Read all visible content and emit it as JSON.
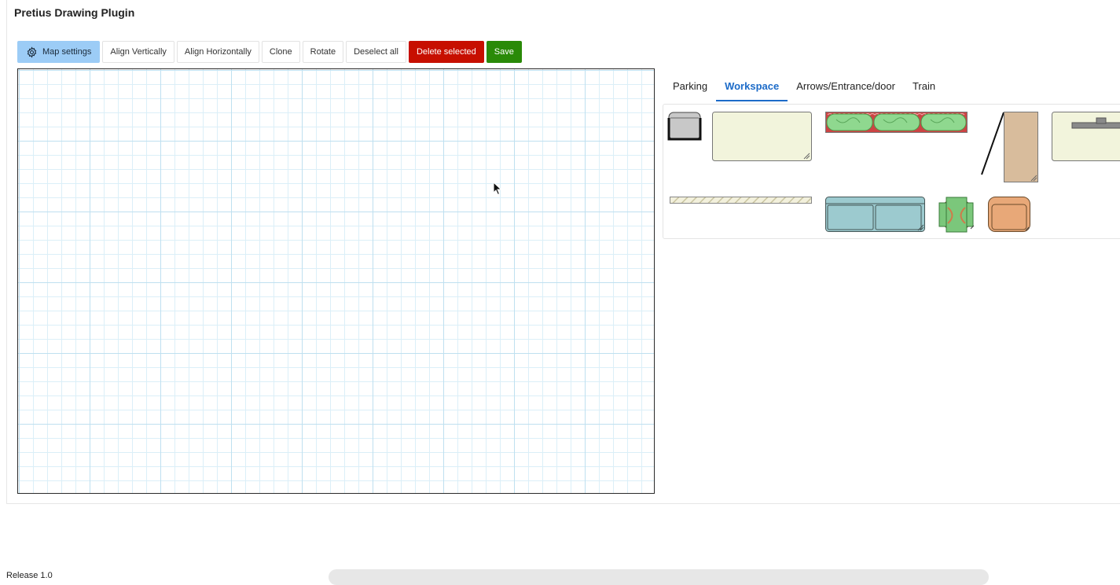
{
  "app": {
    "title": "Pretius Drawing Plugin"
  },
  "toolbar": {
    "map_settings": "Map settings",
    "map_settings_icon": "gear-icon",
    "align_vertically": "Align Vertically",
    "align_horizontally": "Align Horizontally",
    "clone": "Clone",
    "rotate": "Rotate",
    "deselect_all": "Deselect all",
    "delete_selected": "Delete selected",
    "save": "Save"
  },
  "tabs": [
    {
      "label": "Parking",
      "active": false
    },
    {
      "label": "Workspace",
      "active": true
    },
    {
      "label": "Arrows/Entrance/door",
      "active": false
    },
    {
      "label": "Train",
      "active": false
    }
  ],
  "palette": {
    "items": [
      "chair-shape",
      "desk-shape",
      "plant-row-shape",
      "door-shape",
      "desk-with-monitor-shape",
      "wall-shape",
      "sofa-shape",
      "round-table-plant-shape",
      "armchair-shape"
    ]
  },
  "colors": {
    "primary": "#9cccf6",
    "danger": "#c70f00",
    "success": "#2a8a08",
    "active_tab": "#1c6bc8",
    "grid": "#bfe0f0"
  },
  "footer": {
    "release": "Release 1.0"
  }
}
